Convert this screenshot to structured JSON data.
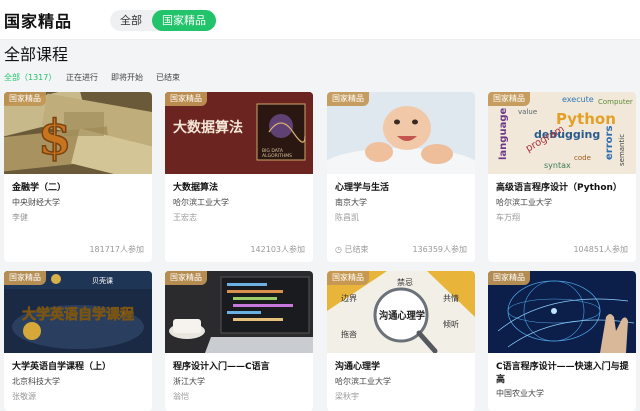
{
  "header": {
    "brand": "国家精品",
    "segments": [
      "全部",
      "国家精品"
    ]
  },
  "heading": "全部课程",
  "filters": [
    "全部（1317）",
    "正在进行",
    "即将开始",
    "已结束"
  ],
  "colors": {
    "accent": "#21c46a",
    "tag": "#c29654"
  },
  "courses": [
    {
      "tag": "国家精品",
      "title": "金融学（二）",
      "school": "中央财经大学",
      "teacher": "李健",
      "status": "",
      "count": "181717人参加",
      "thumb": "dollar-bills"
    },
    {
      "tag": "国家精品",
      "title": "大数据算法",
      "school": "哈尔滨工业大学",
      "teacher": "王宏志",
      "status": "",
      "count": "142103人参加",
      "thumb": "big-data-book"
    },
    {
      "tag": "国家精品",
      "title": "心理学与生活",
      "school": "南京大学",
      "teacher": "陈昌凯",
      "status": "已结束",
      "count": "136359人参加",
      "thumb": "smiling-baby"
    },
    {
      "tag": "国家精品",
      "title": "高级语言程序设计（Python）",
      "school": "哈尔滨工业大学",
      "teacher": "车万翔",
      "status": "",
      "count": "104851人参加",
      "thumb": "python-wordcloud"
    },
    {
      "tag": "国家精品",
      "title": "大学英语自学课程（上）",
      "school": "北京科技大学",
      "teacher": "张敬源",
      "status": "",
      "count": "",
      "thumb": "english-course-banner",
      "banner_text": "大学英语自学课程",
      "banner_logo": "贝壳课"
    },
    {
      "tag": "国家精品",
      "title": "程序设计入门——C语言",
      "school": "浙江大学",
      "teacher": "翁恺",
      "status": "",
      "count": "",
      "thumb": "laptop-code"
    },
    {
      "tag": "国家精品",
      "title": "沟通心理学",
      "school": "哈尔滨工业大学",
      "teacher": "梁秋宇",
      "status": "",
      "count": "",
      "thumb": "magnifier-words",
      "words": [
        "禁忌",
        "边界",
        "共情",
        "拖沓",
        "倾听",
        "沟通心理学"
      ]
    },
    {
      "tag": "国家精品",
      "title": "C语言程序设计——快速入门与提高",
      "school": "中国农业大学",
      "teacher": "",
      "status": "",
      "count": "",
      "thumb": "hand-globe"
    }
  ]
}
